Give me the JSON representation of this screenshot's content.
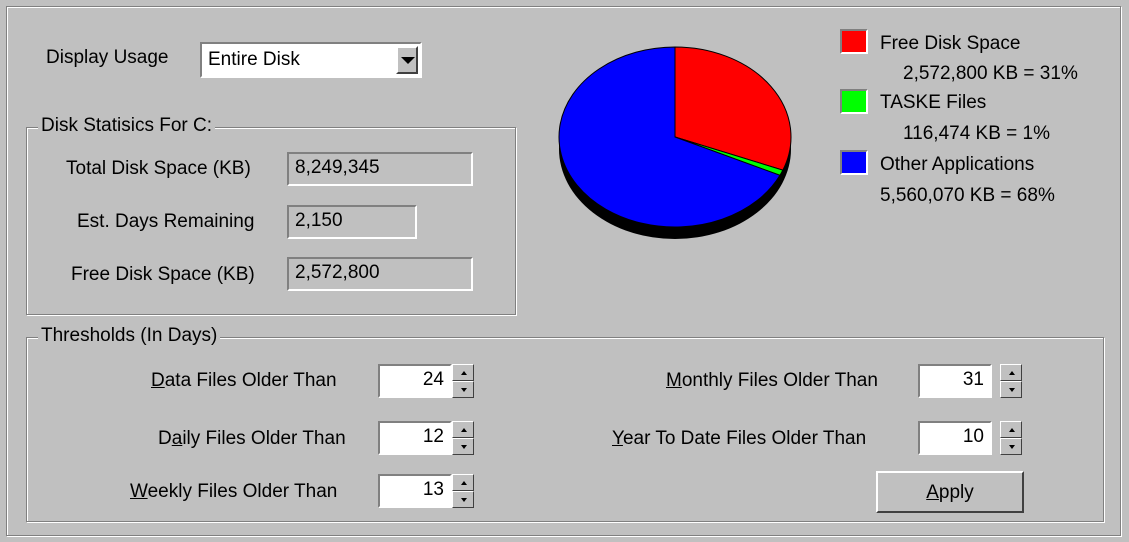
{
  "display_usage": {
    "label": "Display Usage",
    "selected": "Entire Disk"
  },
  "disk_stats": {
    "title": "Disk Statisics For C:",
    "total_label": "Total Disk Space (KB)",
    "total_value": "8,249,345",
    "days_label": "Est. Days Remaining",
    "days_value": "2,150",
    "free_label": "Free Disk Space (KB)",
    "free_value": "2,572,800"
  },
  "legend": [
    {
      "name": "Free Disk Space",
      "detail": "2,572,800 KB = 31%",
      "color": "#ff0000"
    },
    {
      "name": "TASKE Files",
      "detail": "116,474 KB = 1%",
      "color": "#00ff00"
    },
    {
      "name": "Other Applications",
      "detail": "5,560,070 KB = 68%",
      "color": "#0000ff"
    }
  ],
  "chart_data": {
    "type": "pie",
    "title": "",
    "slices": [
      {
        "label": "Free Disk Space",
        "value": 31,
        "color": "#ff0000"
      },
      {
        "label": "TASKE Files",
        "value": 1,
        "color": "#00ff00"
      },
      {
        "label": "Other Applications",
        "value": 68,
        "color": "#0000ff"
      }
    ]
  },
  "thresholds": {
    "title": "Thresholds (In Days)",
    "data": {
      "prefix": "",
      "accel": "D",
      "rest": "ata Files Older Than",
      "value": "24"
    },
    "daily": {
      "prefix": "D",
      "accel": "a",
      "rest": "ily Files Older Than",
      "value": "12"
    },
    "weekly": {
      "prefix": "",
      "accel": "W",
      "rest": "eekly Files Older Than",
      "value": "13"
    },
    "monthly": {
      "prefix": "",
      "accel": "M",
      "rest": "onthly Files Older Than",
      "value": "31"
    },
    "ytd": {
      "prefix": "",
      "accel": "Y",
      "rest": "ear To Date Files Older Than",
      "value": "10"
    }
  },
  "apply": {
    "prefix": "",
    "accel": "A",
    "rest": "pply"
  }
}
